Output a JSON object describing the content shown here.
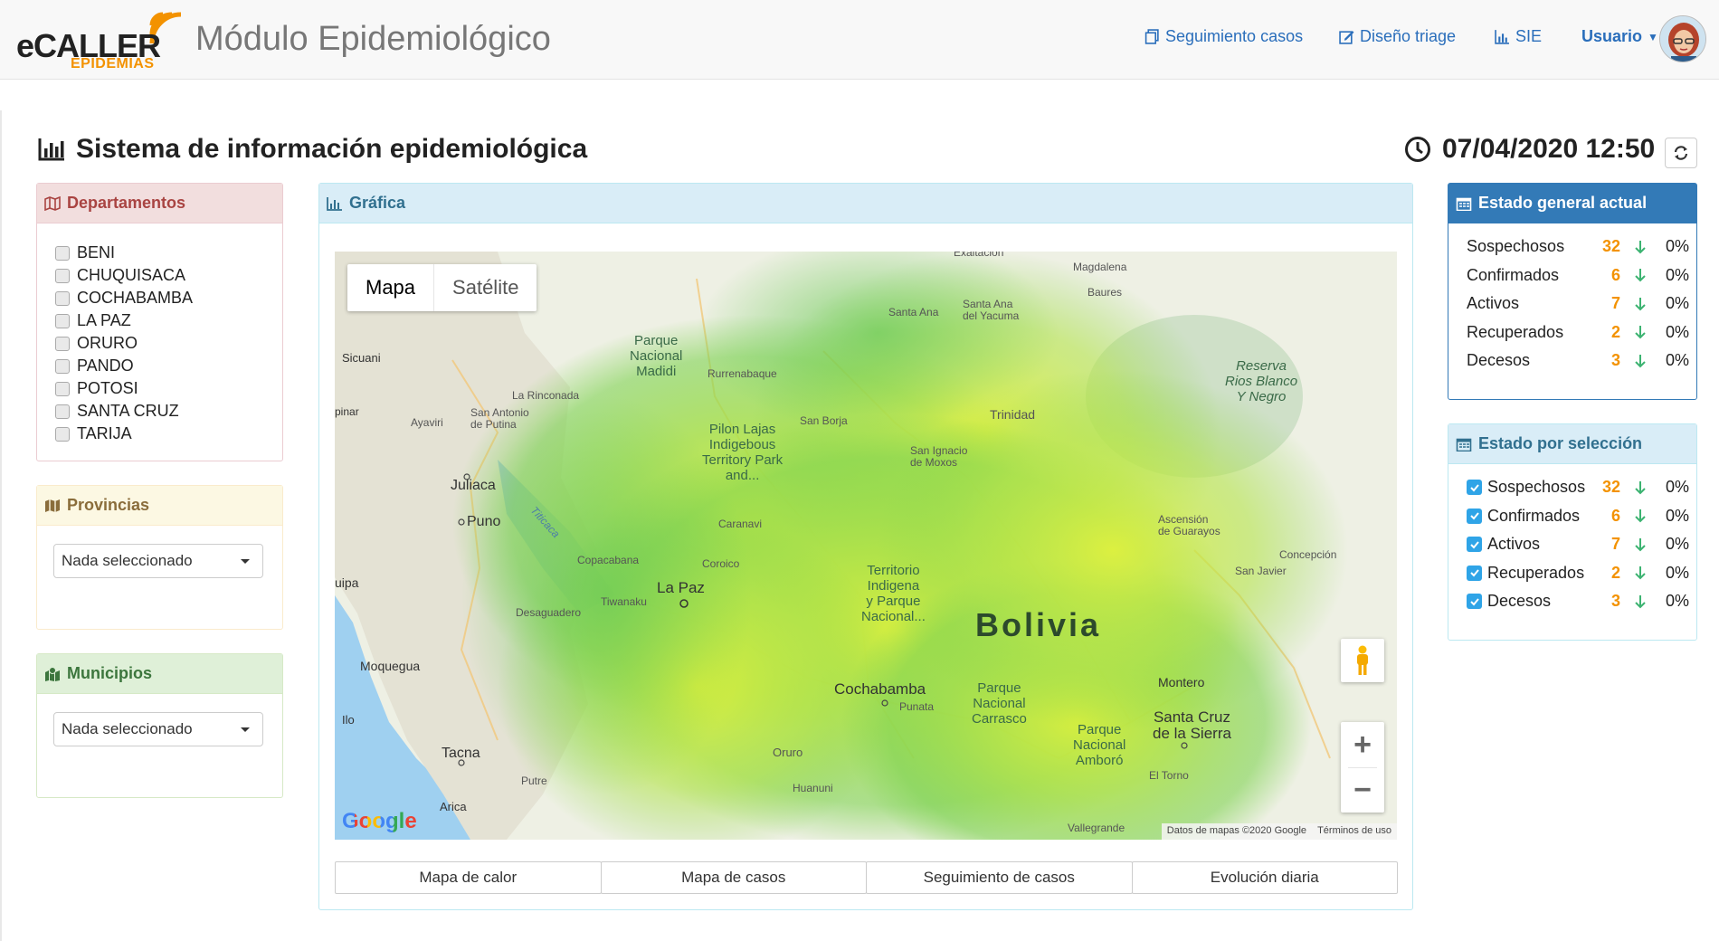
{
  "header": {
    "logo_main": "eCALLER",
    "logo_sub": "EPIDEMIAS",
    "app_title": "Módulo Epidemiológico",
    "nav": [
      "Seguimiento casos",
      "Diseño triage",
      "SIE"
    ],
    "user": "Usuario"
  },
  "page": {
    "title": "Sistema de información epidemiológica",
    "datetime": "07/04/2020 12:50"
  },
  "departamentos": {
    "title": "Departamentos",
    "items": [
      "BENI",
      "CHUQUISACA",
      "COCHABAMBA",
      "LA PAZ",
      "ORURO",
      "PANDO",
      "POTOSI",
      "SANTA CRUZ",
      "TARIJA"
    ]
  },
  "provincias": {
    "title": "Provincias",
    "select": "Nada seleccionado"
  },
  "municipios": {
    "title": "Municipios",
    "select": "Nada seleccionado"
  },
  "grafica": {
    "title": "Gráfica",
    "map_types": [
      "Mapa",
      "Satélite"
    ],
    "attribution": "Datos de mapas ©2020 Google",
    "terms": "Términos de uso",
    "google": "Google",
    "labels": {
      "bolivia": "Bolivia",
      "la_paz": "La Paz",
      "cochabamba": "Cochabamba",
      "santa_cruz_1": "Santa Cruz",
      "santa_cruz_2": "de la Sierra",
      "trinidad": "Trinidad",
      "oruro": "Oruro",
      "puno": "Puno",
      "juliaca": "Juliaca",
      "tacna": "Tacna",
      "moquegua": "Moquegua",
      "arica": "Arica",
      "montero": "Montero",
      "reserva_1": "Reserva",
      "reserva_2": "Rios Blanco",
      "reserva_3": "Y Negro",
      "madidi_1": "Parque",
      "madidi_2": "Nacional",
      "madidi_3": "Madidi",
      "pilon_1": "Pilon Lajas",
      "pilon_2": "Indigebous",
      "pilon_3": "Territory Park",
      "pilon_4": "and...",
      "tip_1": "Territorio",
      "tip_2": "Indigena",
      "tip_3": "y Parque",
      "tip_4": "Nacional...",
      "carrasco_1": "Parque",
      "carrasco_2": "Nacional",
      "carrasco_3": "Carrasco",
      "amboro_1": "Parque",
      "amboro_2": "Nacional",
      "amboro_3": "Amboró",
      "titicaca": "Titicaca",
      "concepcion": "Concepción",
      "san_javier": "San Javier",
      "ascension_1": "Ascensión",
      "ascension_2": "de Guarayos",
      "san_borja": "San Borja",
      "san_ignacio_1": "San Ignacio",
      "san_ignacio_2": "de Moxos",
      "santa_ana": "Santa Ana",
      "santa_ana_yacuma_1": "Santa Ana",
      "santa_ana_yacuma_2": "del Yacuma",
      "magdalena": "Magdalena",
      "baures": "Baures",
      "sicuani": "Sicuani",
      "rurrenabaque": "Rurrenabaque",
      "la_rinconada": "La Rinconada",
      "san_antonio_1": "San Antonio",
      "san_antonio_2": "de Putina",
      "ayaviri": "Ayaviri",
      "copacabana": "Copacabana",
      "desaguadero": "Desaguadero",
      "tiwanaku": "Tiwanaku",
      "caranavi": "Caranavi",
      "coroico": "Coroico",
      "punata": "Punata",
      "huanuni": "Huanuni",
      "putre": "Putre",
      "el_torno": "El Torno",
      "vallegrande": "Vallegrande",
      "exaltacion": "Exaltación",
      "ilo": "Ilo",
      "pinpar": "pinar",
      "uipa": "uipa"
    }
  },
  "map_buttons": [
    "Mapa de calor",
    "Mapa de casos",
    "Seguimiento de casos",
    "Evolución diaria"
  ],
  "estado_general": {
    "title": "Estado general actual",
    "rows": [
      {
        "label": "Sospechosos",
        "count": "32",
        "pct": "0%"
      },
      {
        "label": "Confirmados",
        "count": "6",
        "pct": "0%"
      },
      {
        "label": "Activos",
        "count": "7",
        "pct": "0%"
      },
      {
        "label": "Recuperados",
        "count": "2",
        "pct": "0%"
      },
      {
        "label": "Decesos",
        "count": "3",
        "pct": "0%"
      }
    ]
  },
  "estado_seleccion": {
    "title": "Estado por selección",
    "rows": [
      {
        "label": "Sospechosos",
        "count": "32",
        "pct": "0%"
      },
      {
        "label": "Confirmados",
        "count": "6",
        "pct": "0%"
      },
      {
        "label": "Activos",
        "count": "7",
        "pct": "0%"
      },
      {
        "label": "Recuperados",
        "count": "2",
        "pct": "0%"
      },
      {
        "label": "Decesos",
        "count": "3",
        "pct": "0%"
      }
    ]
  },
  "colors": {
    "accent": "#2a6ebb",
    "count": "#f39200",
    "arrow": "#3cb371",
    "check": "#2fa4e7"
  }
}
